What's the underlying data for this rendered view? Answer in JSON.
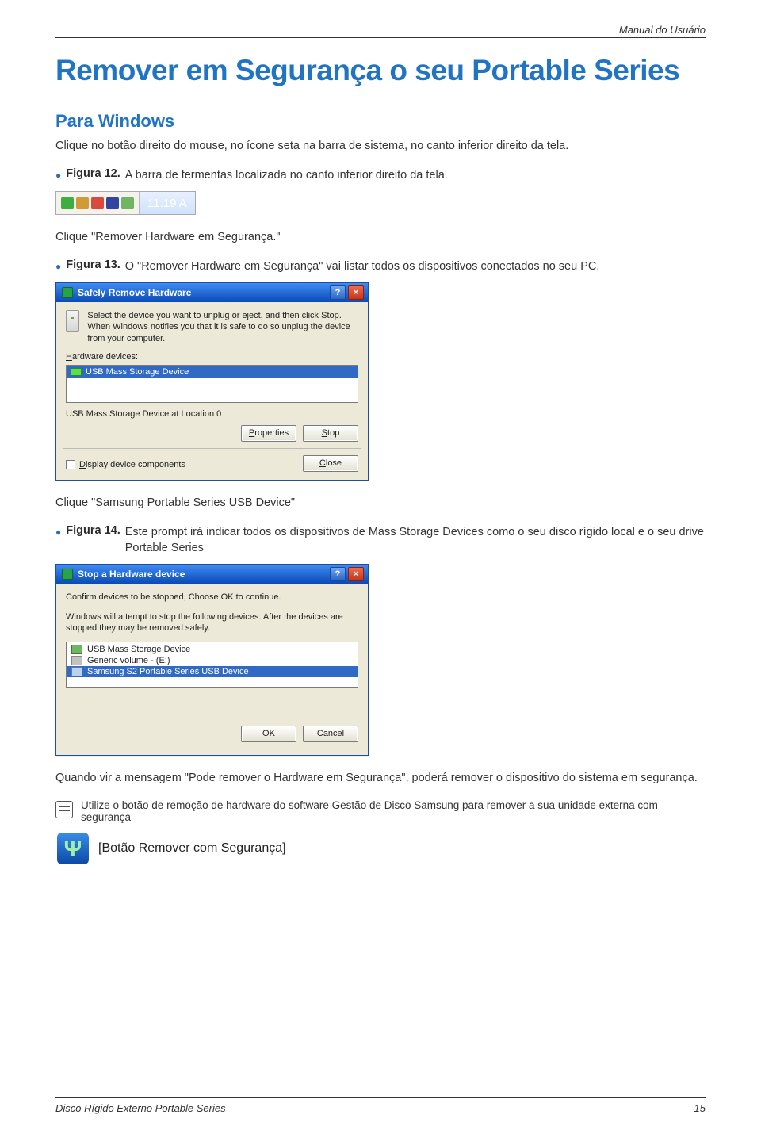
{
  "header": {
    "title": "Manual do Usuário"
  },
  "page": {
    "title": "Remover em Segurança o seu Portable Series",
    "subtitle": "Para Windows",
    "intro": "Clique no botão direito do mouse, no ícone seta na barra de sistema, no canto inferior direito da tela.",
    "fig12_label": "Figura 12.",
    "fig12_text": "A barra de fermentas localizada no canto inferior direito da tela.",
    "systray_time": "11:19 A",
    "after_fig12": "Clique \"Remover Hardware em Segurança.\"",
    "fig13_label": "Figura 13.",
    "fig13_text": "O \"Remover Hardware em Segurança\" vai listar todos os dispositivos conectados no seu PC.",
    "after_fig13": "Clique \"Samsung Portable Series USB Device\"",
    "fig14_label": "Figura 14.",
    "fig14_text": "Este prompt irá indicar todos os dispositivos de Mass Storage Devices como o seu disco rígido local e o seu drive Portable Series",
    "after_fig14": "Quando vir a mensagem \"Pode remover o Hardware em Segurança\", poderá remover o dispositivo do sistema em segurança.",
    "note_text": "Utilize o botão de remoção de hardware do software Gestão de Disco Samsung para remover a sua unidade externa com segurança",
    "remove_caption": "[Botão Remover com Segurança]"
  },
  "dlg1": {
    "title": "Safely Remove Hardware",
    "info": "Select the device you want to unplug or eject, and then click Stop. When Windows notifies you that it is safe to do so unplug the device from your computer.",
    "devices_label_html": "H",
    "devices_label_rest": "ardware devices:",
    "list_item": "USB Mass Storage Device",
    "status_line": "USB Mass Storage Device at Location 0",
    "properties_html": "P",
    "properties_rest": "roperties",
    "stop_html": "S",
    "stop_rest": "top",
    "checkbox_html": "D",
    "checkbox_rest": "isplay device components",
    "close_html": "C",
    "close_rest": "lose"
  },
  "dlg2": {
    "title": "Stop a Hardware device",
    "line1": "Confirm devices to be stopped, Choose OK to continue.",
    "line2": "Windows will attempt to stop the following devices. After the devices are stopped they may be removed safely.",
    "item1": "USB Mass Storage Device",
    "item2": "Generic volume - (E:)",
    "item3": "Samsung S2 Portable Series USB Device",
    "ok": "OK",
    "cancel": "Cancel"
  },
  "footer": {
    "left": "Disco Rígido Externo Portable Series",
    "page": "15"
  }
}
